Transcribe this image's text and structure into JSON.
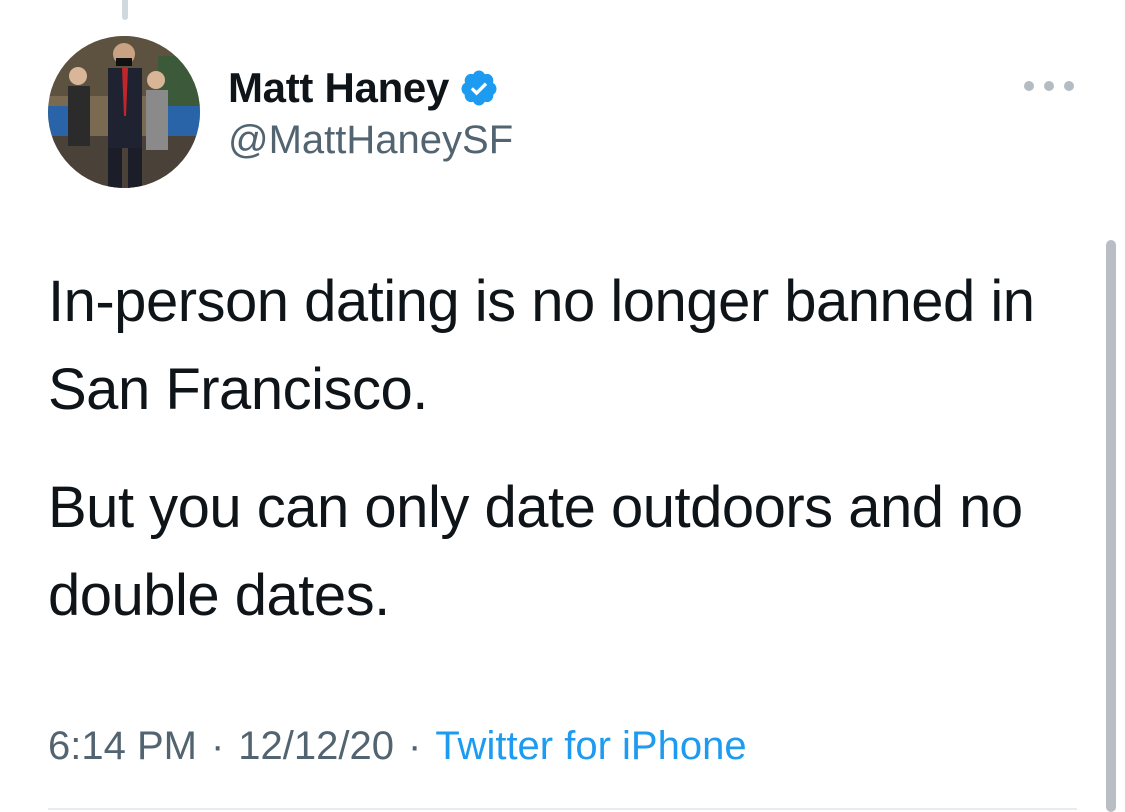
{
  "author": {
    "display_name": "Matt Haney",
    "handle": "@MattHaneySF",
    "verified": true,
    "avatar_icon": "avatar-photo"
  },
  "menu": {
    "icon": "more-options-icon"
  },
  "tweet": {
    "paragraphs": [
      "In-person dating is no longer banned in San Francisco.",
      "But you can only date outdoors and no double dates."
    ]
  },
  "meta": {
    "time": "6:14 PM",
    "separator": "·",
    "date": "12/12/20",
    "source": "Twitter for iPhone"
  },
  "colors": {
    "text": "#0f1419",
    "secondary": "#536471",
    "link": "#1d9bf0",
    "verified": "#1d9bf0"
  }
}
